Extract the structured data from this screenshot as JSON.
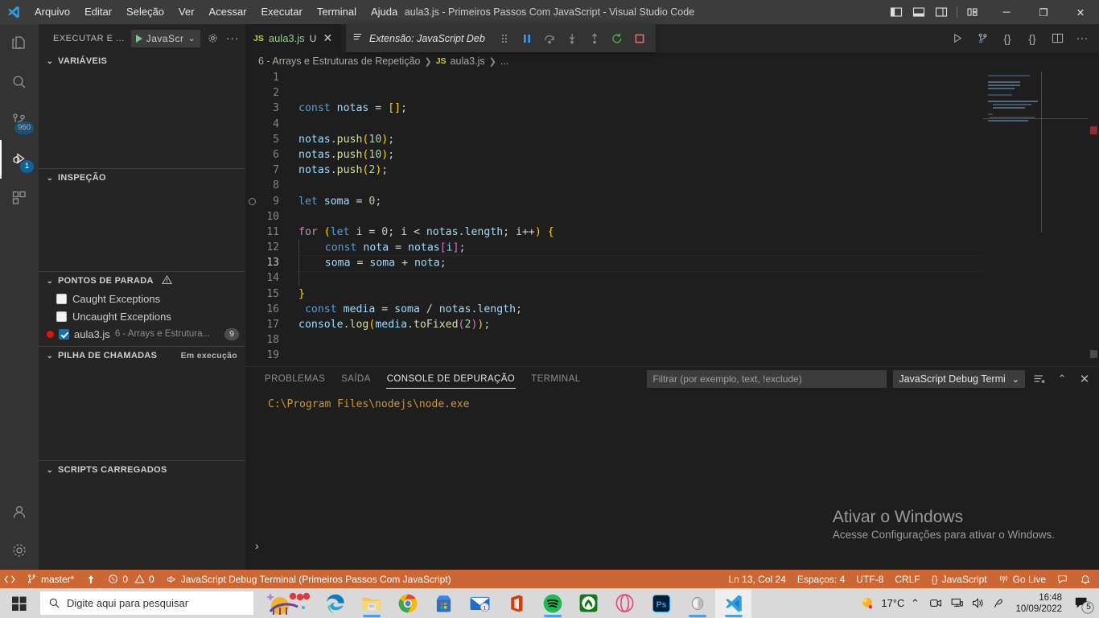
{
  "window": {
    "title": "aula3.js - Primeiros Passos Com JavaScript - Visual Studio Code",
    "menu": [
      "Arquivo",
      "Editar",
      "Seleção",
      "Ver",
      "Acessar",
      "Executar",
      "Terminal",
      "Ajuda"
    ],
    "controls": {
      "minimize": "─",
      "maximize": "❐",
      "close": "✕"
    },
    "layout_icons": [
      "toggle-primary-sidebar-icon",
      "toggle-panel-icon",
      "toggle-secondary-sidebar-icon",
      "customize-layout-icon"
    ]
  },
  "activity_bar": {
    "items": [
      {
        "name": "explorer",
        "icon": "files-icon",
        "badge": ""
      },
      {
        "name": "search",
        "icon": "search-icon",
        "badge": ""
      },
      {
        "name": "source-control",
        "icon": "source-control-icon",
        "badge": "960"
      },
      {
        "name": "run-and-debug",
        "icon": "run-debug-icon",
        "badge": "1",
        "active": true
      },
      {
        "name": "extensions",
        "icon": "extensions-icon",
        "badge": ""
      }
    ],
    "bottom": [
      {
        "name": "accounts",
        "icon": "account-icon"
      },
      {
        "name": "manage",
        "icon": "gear-icon"
      }
    ]
  },
  "sidebar": {
    "title": "EXECUTAR E ...",
    "launch_config": "JavaScr",
    "launch_chevron": "⌄",
    "gear_icon": "gear-icon",
    "more_icon": "more-actions-icon",
    "panes": [
      {
        "title": "VARIÁVEIS",
        "chevron": "⌄"
      },
      {
        "title": "INSPEÇÃO",
        "chevron": "⌄"
      },
      {
        "title": "PONTOS DE PARADA",
        "chevron": "⌄",
        "warning_icon": "warning-icon"
      },
      {
        "title": "PILHA DE CHAMADAS",
        "chevron": "⌄",
        "sub": "Em execução"
      },
      {
        "title": "SCRIPTS CARREGADOS",
        "chevron": "⌄"
      }
    ],
    "breakpoints": [
      {
        "label": "Caught Exceptions",
        "checked": false,
        "type": "exception"
      },
      {
        "label": "Uncaught Exceptions",
        "checked": false,
        "type": "exception"
      },
      {
        "label": "aula3.js",
        "path": "6 - Arrays e Estrutura...",
        "line": "9",
        "checked": true,
        "type": "file"
      }
    ]
  },
  "editor": {
    "tab": {
      "badge": "JS",
      "name": "aula3.js",
      "dirty": "U",
      "close": "✕"
    },
    "debug_tab": {
      "label": "Extensão: JavaScript Deb",
      "icon": "list-icon"
    },
    "debug_toolbar": [
      {
        "name": "drag-handle",
        "icon": "grip-icon"
      },
      {
        "name": "pause-button",
        "icon": "pause-icon"
      },
      {
        "name": "step-over-button",
        "icon": "step-over-icon"
      },
      {
        "name": "step-into-button",
        "icon": "step-into-icon"
      },
      {
        "name": "step-out-button",
        "icon": "step-out-icon"
      },
      {
        "name": "restart-button",
        "icon": "restart-icon"
      },
      {
        "name": "stop-button",
        "icon": "stop-icon"
      }
    ],
    "editor_actions": [
      "run-button",
      "run-debug-button",
      "braces-icon",
      "braces-alt-icon",
      "split-editor-icon",
      "more-actions-icon"
    ],
    "breadcrumb": [
      "6 - Arrays e Estruturas de Repetição",
      "aula3.js",
      "..."
    ],
    "breadcrumb_file_badge": "JS",
    "lines": [
      {
        "n": "1",
        "tokens": []
      },
      {
        "n": "2",
        "tokens": []
      },
      {
        "n": "3",
        "tokens": [
          {
            "t": "const",
            "c": "kw"
          },
          {
            "t": " ",
            "c": "op"
          },
          {
            "t": "notas",
            "c": "var"
          },
          {
            "t": " = ",
            "c": "op"
          },
          {
            "t": "[",
            "c": "brk-y"
          },
          {
            "t": "]",
            "c": "brk-y"
          },
          {
            "t": ";",
            "c": "punct"
          }
        ]
      },
      {
        "n": "4",
        "tokens": []
      },
      {
        "n": "5",
        "tokens": [
          {
            "t": "notas",
            "c": "var"
          },
          {
            "t": ".",
            "c": "punct"
          },
          {
            "t": "push",
            "c": "fn"
          },
          {
            "t": "(",
            "c": "brk-y"
          },
          {
            "t": "10",
            "c": "num"
          },
          {
            "t": ")",
            "c": "brk-y"
          },
          {
            "t": ";",
            "c": "punct"
          }
        ]
      },
      {
        "n": "6",
        "tokens": [
          {
            "t": "notas",
            "c": "var"
          },
          {
            "t": ".",
            "c": "punct"
          },
          {
            "t": "push",
            "c": "fn"
          },
          {
            "t": "(",
            "c": "brk-y"
          },
          {
            "t": "10",
            "c": "num"
          },
          {
            "t": ")",
            "c": "brk-y"
          },
          {
            "t": ";",
            "c": "punct"
          }
        ]
      },
      {
        "n": "7",
        "tokens": [
          {
            "t": "notas",
            "c": "var"
          },
          {
            "t": ".",
            "c": "punct"
          },
          {
            "t": "push",
            "c": "fn"
          },
          {
            "t": "(",
            "c": "brk-y"
          },
          {
            "t": "2",
            "c": "num"
          },
          {
            "t": ")",
            "c": "brk-y"
          },
          {
            "t": ";",
            "c": "punct"
          }
        ]
      },
      {
        "n": "8",
        "tokens": []
      },
      {
        "n": "9",
        "tokens": [
          {
            "t": "let",
            "c": "kw"
          },
          {
            "t": " ",
            "c": "op"
          },
          {
            "t": "soma",
            "c": "var"
          },
          {
            "t": " = ",
            "c": "op"
          },
          {
            "t": "0",
            "c": "num"
          },
          {
            "t": ";",
            "c": "punct"
          }
        ],
        "breakpoint_glyph": true
      },
      {
        "n": "10",
        "tokens": []
      },
      {
        "n": "11",
        "tokens": [
          {
            "t": "for",
            "c": "kw2"
          },
          {
            "t": " ",
            "c": "op"
          },
          {
            "t": "(",
            "c": "brk-y"
          },
          {
            "t": "let",
            "c": "kw"
          },
          {
            "t": " i = ",
            "c": "op"
          },
          {
            "t": "0",
            "c": "num"
          },
          {
            "t": "; i < ",
            "c": "op"
          },
          {
            "t": "notas",
            "c": "var"
          },
          {
            "t": ".",
            "c": "punct"
          },
          {
            "t": "length",
            "c": "var"
          },
          {
            "t": "; i++",
            "c": "op"
          },
          {
            "t": ")",
            "c": "brk-y"
          },
          {
            "t": " ",
            "c": "op"
          },
          {
            "t": "{",
            "c": "brk-y"
          }
        ]
      },
      {
        "n": "12",
        "indent": 1,
        "tokens": [
          {
            "t": "    ",
            "c": "op"
          },
          {
            "t": "const",
            "c": "kw"
          },
          {
            "t": " ",
            "c": "op"
          },
          {
            "t": "nota",
            "c": "var"
          },
          {
            "t": " = ",
            "c": "op"
          },
          {
            "t": "notas",
            "c": "var"
          },
          {
            "t": "[",
            "c": "brk-p"
          },
          {
            "t": "i",
            "c": "var"
          },
          {
            "t": "]",
            "c": "brk-p"
          },
          {
            "t": ";",
            "c": "punct"
          }
        ]
      },
      {
        "n": "13",
        "indent": 1,
        "current": true,
        "tokens": [
          {
            "t": "    ",
            "c": "op"
          },
          {
            "t": "soma",
            "c": "var"
          },
          {
            "t": " = ",
            "c": "op"
          },
          {
            "t": "soma",
            "c": "var"
          },
          {
            "t": " + ",
            "c": "op"
          },
          {
            "t": "nota",
            "c": "var"
          },
          {
            "t": ";",
            "c": "punct"
          }
        ]
      },
      {
        "n": "14",
        "indent": 1,
        "tokens": []
      },
      {
        "n": "15",
        "tokens": [
          {
            "t": "}",
            "c": "brk-y"
          }
        ]
      },
      {
        "n": "16",
        "tokens": [
          {
            "t": " ",
            "c": "op"
          },
          {
            "t": "const",
            "c": "kw"
          },
          {
            "t": " ",
            "c": "op"
          },
          {
            "t": "media",
            "c": "var"
          },
          {
            "t": " = ",
            "c": "op"
          },
          {
            "t": "soma",
            "c": "var"
          },
          {
            "t": " / ",
            "c": "op"
          },
          {
            "t": "notas",
            "c": "var"
          },
          {
            "t": ".",
            "c": "punct"
          },
          {
            "t": "length",
            "c": "var"
          },
          {
            "t": ";",
            "c": "punct"
          }
        ]
      },
      {
        "n": "17",
        "tokens": [
          {
            "t": "console",
            "c": "var"
          },
          {
            "t": ".",
            "c": "punct"
          },
          {
            "t": "log",
            "c": "fn"
          },
          {
            "t": "(",
            "c": "brk-y"
          },
          {
            "t": "media",
            "c": "var"
          },
          {
            "t": ".",
            "c": "punct"
          },
          {
            "t": "toFixed",
            "c": "fn"
          },
          {
            "t": "(",
            "c": "brk-p"
          },
          {
            "t": "2",
            "c": "num"
          },
          {
            "t": ")",
            "c": "brk-p"
          },
          {
            "t": ")",
            "c": "brk-y"
          },
          {
            "t": ";",
            "c": "punct"
          }
        ]
      },
      {
        "n": "18",
        "tokens": []
      },
      {
        "n": "19",
        "tokens": []
      }
    ]
  },
  "panel": {
    "tabs": [
      {
        "label": "PROBLEMAS",
        "active": false
      },
      {
        "label": "SAÍDA",
        "active": false
      },
      {
        "label": "CONSOLE DE DEPURAÇÃO",
        "active": true
      },
      {
        "label": "TERMINAL",
        "active": false
      }
    ],
    "filter_placeholder": "Filtrar (por exemplo, text, !exclude)",
    "filter_value": "",
    "terminal_select": "JavaScript Debug Termi",
    "terminal_chevron": "⌄",
    "actions": [
      "clear-console-icon",
      "maximize-panel-icon",
      "close-panel-icon"
    ],
    "console_output": "C:\\Program Files\\nodejs\\node.exe",
    "prompt_arrow": "›"
  },
  "watermark": {
    "line1": "Ativar o Windows",
    "line2": "Acesse Configurações para ativar o Windows."
  },
  "status_bar": {
    "left": [
      {
        "name": "remote-indicator",
        "icon": "remote-icon",
        "label": ""
      },
      {
        "name": "branch",
        "icon": "branch-icon",
        "label": "master*"
      },
      {
        "name": "sync",
        "icon": "sync-icon",
        "label": ""
      },
      {
        "name": "problems",
        "icon": "error-icon",
        "label": "0",
        "icon2": "warning-icon",
        "label2": "0"
      },
      {
        "name": "debug-terminal",
        "icon": "debug-icon",
        "label": "JavaScript Debug Terminal (Primeiros Passos Com JavaScript)"
      }
    ],
    "right": [
      {
        "name": "cursor-position",
        "label": "Ln 13, Col 24"
      },
      {
        "name": "indentation",
        "label": "Espaços: 4"
      },
      {
        "name": "encoding",
        "label": "UTF-8"
      },
      {
        "name": "eol",
        "label": "CRLF"
      },
      {
        "name": "language-mode",
        "label": "JavaScript",
        "icon": "braces-icon"
      },
      {
        "name": "go-live",
        "label": "Go Live",
        "icon": "broadcast-icon"
      },
      {
        "name": "feedback",
        "label": "",
        "icon": "feedback-icon"
      },
      {
        "name": "notifications",
        "label": "",
        "icon": "bell-icon"
      }
    ]
  },
  "taskbar": {
    "start_icon": "windows-start-icon",
    "search_placeholder": "Digite aqui para pesquisar",
    "search_icon": "search-icon",
    "apps": [
      {
        "name": "cortana-widget",
        "icon": "cortana-icon"
      },
      {
        "name": "microsoft-edge",
        "icon": "edge-icon"
      },
      {
        "name": "file-explorer",
        "icon": "folder-icon",
        "running": true
      },
      {
        "name": "google-chrome",
        "icon": "chrome-icon"
      },
      {
        "name": "microsoft-store",
        "icon": "store-icon"
      },
      {
        "name": "mail",
        "icon": "mail-icon",
        "badge": "1"
      },
      {
        "name": "microsoft-office",
        "icon": "office-icon"
      },
      {
        "name": "spotify",
        "icon": "spotify-icon",
        "running": true
      },
      {
        "name": "xbox",
        "icon": "xbox-icon"
      },
      {
        "name": "opera",
        "icon": "opera-icon"
      },
      {
        "name": "photoshop",
        "icon": "photoshop-icon"
      },
      {
        "name": "volume-app",
        "icon": "speaker-icon",
        "running": true
      },
      {
        "name": "visual-studio-code",
        "icon": "vscode-icon",
        "running": true,
        "active": true
      }
    ],
    "tray": {
      "weather_temp": "17°C",
      "weather_icon": "sun-icon",
      "chevron": "⌃",
      "icons": [
        "meet-now-icon",
        "network-icon",
        "volume-icon",
        "pen-icon"
      ],
      "time": "16:48",
      "date": "10/09/2022",
      "notifications_badge": "5",
      "notifications_icon": "action-center-icon"
    }
  },
  "colors": {
    "titlebar": "#3c3c3c",
    "activitybar": "#333333",
    "sidebar": "#252526",
    "editor": "#1e1e1e",
    "status_debug": "#cc6633",
    "accent": "#0e639c",
    "breakpoint": "#e51400",
    "taskbar": "#d9d9d9"
  }
}
